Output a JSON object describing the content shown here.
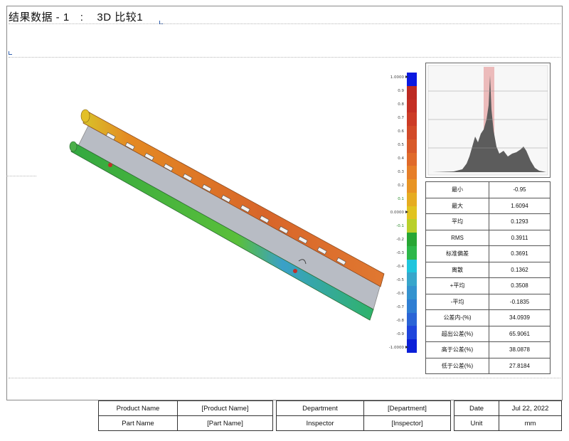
{
  "header": {
    "title": "结果数据 - 1",
    "separator": ":",
    "comparison": "3D 比较1"
  },
  "color_scale": {
    "labels": [
      "1.0000",
      "0.9",
      "0.8",
      "0.7",
      "0.6",
      "0.5",
      "0.4",
      "0.3",
      "0.2",
      "0.1",
      "0.0000",
      "-0.1",
      "-0.2",
      "-0.3",
      "-0.4",
      "-0.5",
      "-0.6",
      "-0.7",
      "-0.8",
      "-0.9",
      "-1.0000"
    ],
    "colors_top_to_bottom": [
      "#0b1fd8",
      "#1f45dc",
      "#2a64d6",
      "#2f7ed3",
      "#3493cf",
      "#37a6cb",
      "#1fc5dd",
      "#2db74a",
      "#27a634",
      "#b9d02a",
      "#e1c31f",
      "#e6ac20",
      "#e89424",
      "#e67e28",
      "#e06a2a",
      "#d85a2a",
      "#d24a28",
      "#cc3b26",
      "#c42f24",
      "#bc2a22",
      "#0a18e0"
    ]
  },
  "stats": {
    "rows": [
      {
        "label": "最小",
        "value": "-0.95"
      },
      {
        "label": "最大",
        "value": "1.6094"
      },
      {
        "label": "平均",
        "value": "0.1293"
      },
      {
        "label": "RMS",
        "value": "0.3911"
      },
      {
        "label": "标准偏差",
        "value": "0.3691"
      },
      {
        "label": "离散",
        "value": "0.1362"
      },
      {
        "label": "+平均",
        "value": "0.3508"
      },
      {
        "label": "-平均",
        "value": "-0.1835"
      },
      {
        "label": "公差内-(%)",
        "value": "34.0939"
      },
      {
        "label": "超出公差(%)",
        "value": "65.9061"
      },
      {
        "label": "高于公差(%)",
        "value": "38.0878"
      },
      {
        "label": "低于公差(%)",
        "value": "27.8184"
      }
    ]
  },
  "footer": {
    "product": {
      "label": "Product Name",
      "value": "[Product Name]"
    },
    "part": {
      "label": "Part Name",
      "value": "[Part Name]"
    },
    "department": {
      "label": "Department",
      "value": "[Department]"
    },
    "inspector": {
      "label": "Inspector",
      "value": "[Inspector]"
    },
    "date": {
      "label": "Date",
      "value": "Jul 22, 2022"
    },
    "unit": {
      "label": "Unit",
      "value": "mm"
    }
  }
}
